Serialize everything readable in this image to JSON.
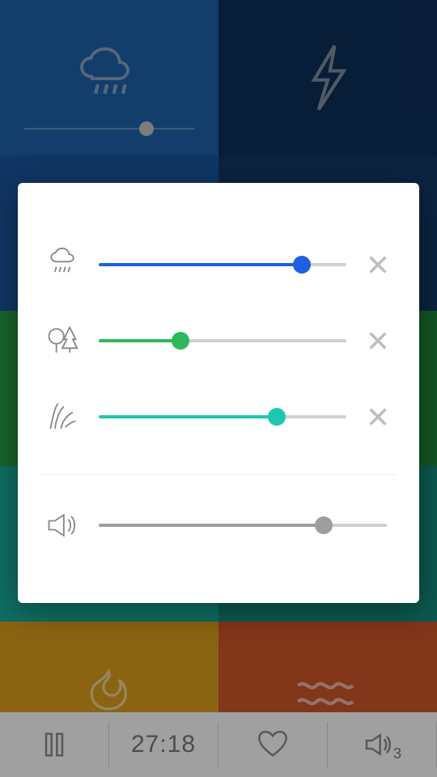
{
  "background": {
    "tiles": [
      {
        "name": "rain",
        "color": "#1f64ad",
        "has_slider": true,
        "slider_pct": 72
      },
      {
        "name": "thunder",
        "color": "#0e2f5a"
      },
      {
        "name": "blue3",
        "color": "#1a57a3"
      },
      {
        "name": "blue4",
        "color": "#143968"
      },
      {
        "name": "green1",
        "color": "#28a24a"
      },
      {
        "name": "green2",
        "color": "#1f8d3e"
      },
      {
        "name": "teal1",
        "color": "#19b3a0"
      },
      {
        "name": "teal2",
        "color": "#139082"
      },
      {
        "name": "fire",
        "color": "#e0a21e"
      },
      {
        "name": "waves",
        "color": "#d2572b"
      }
    ]
  },
  "mixer": {
    "sounds": [
      {
        "name": "rain",
        "icon": "rain",
        "color": "#1f5fe0",
        "value": 82
      },
      {
        "name": "forest",
        "icon": "trees",
        "color": "#2eb85c",
        "value": 33
      },
      {
        "name": "wind",
        "icon": "reeds",
        "color": "#1fc7b0",
        "value": 72
      }
    ],
    "master": {
      "icon": "speaker",
      "value": 78,
      "color": "#9e9e9e"
    }
  },
  "bottom_bar": {
    "timer": "27:18",
    "active_count": "3"
  }
}
